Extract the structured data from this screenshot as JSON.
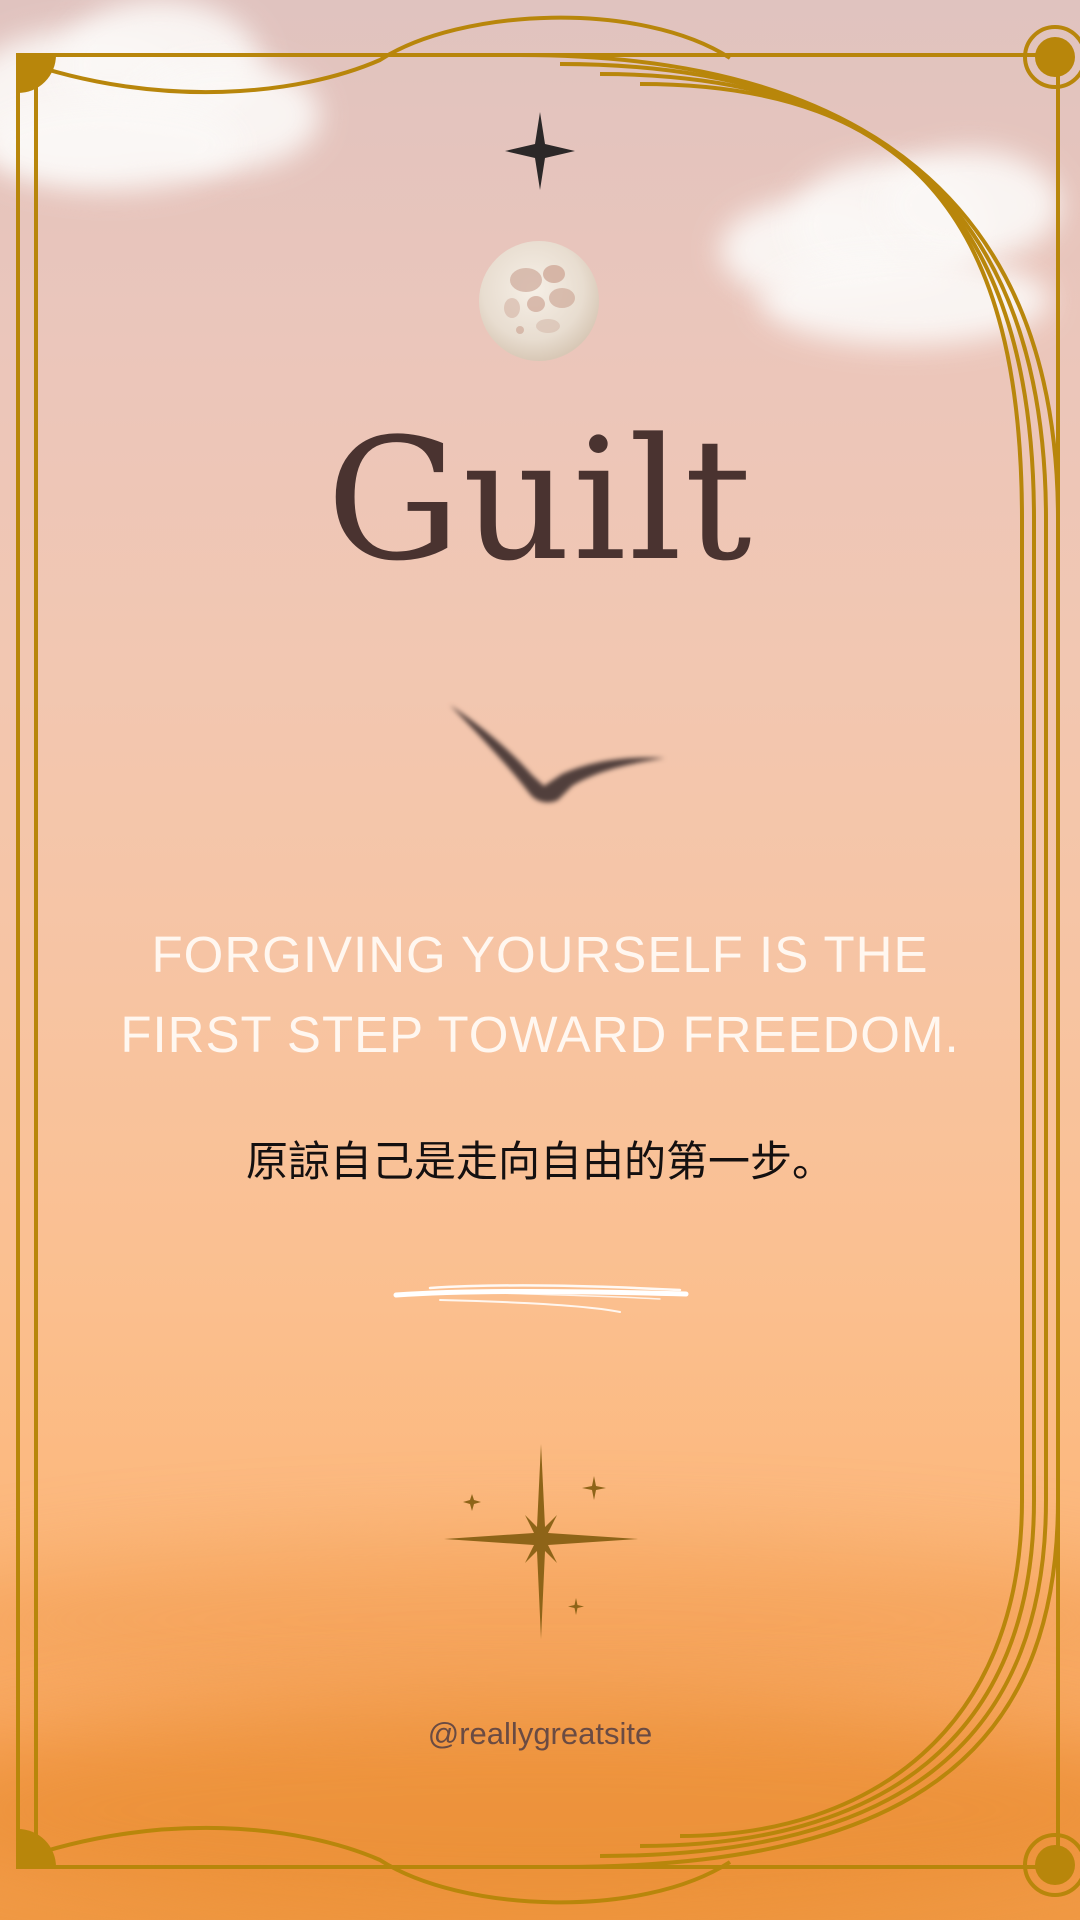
{
  "title": "Guilt",
  "quote": {
    "line1": "FORGIVING YOURSELF IS THE",
    "line2": "FIRST STEP TOWARD FREEDOM."
  },
  "quote_chinese": "原諒自己是走向自由的第一步。",
  "handle": "@reallygreatsite",
  "colors": {
    "frame_gold": "#b8860b",
    "title_brown": "#4a3330",
    "quote_white": "#fff7f0"
  },
  "icons": {
    "top_star": "four-point-star-icon",
    "moon": "full-moon-icon",
    "bird": "flying-bird-icon",
    "brush": "brush-stroke-icon",
    "sparkles": "sparkle-cluster-icon"
  }
}
